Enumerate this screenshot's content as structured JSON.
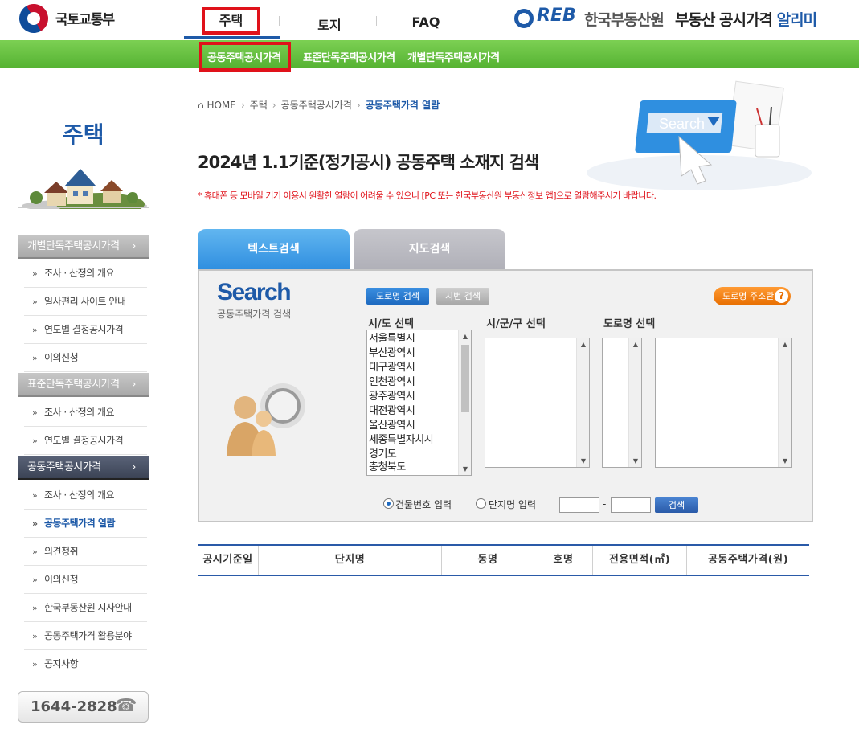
{
  "header": {
    "ministry_name": "국토교통부",
    "nav": [
      "주택",
      "토지",
      "FAQ"
    ],
    "reb_logo": "REB",
    "reb_org": "한국부동산원",
    "reb_service": "부동산 공시가격",
    "reb_service_accent": "알리미"
  },
  "subnav": [
    "공동주택공시가격",
    "표준단독주택공시가격",
    "개별단독주택공시가격"
  ],
  "sidebar": {
    "title": "주택",
    "sections": [
      {
        "label": "개별단독주택공시가격",
        "items": [
          "조사 · 산정의 개요",
          "일사편리 사이트 안내",
          "연도별 결정공시가격",
          "이의신청"
        ]
      },
      {
        "label": "표준단독주택공시가격",
        "items": [
          "조사 · 산정의 개요",
          "연도별 결정공시가격"
        ]
      },
      {
        "label": "공동주택공시가격",
        "items": [
          "조사 · 산정의 개요",
          "공동주택가격 열람",
          "의견청취",
          "이의신청",
          "한국부동산원 지사안내",
          "공동주택가격 활용분야",
          "공지사항"
        ]
      }
    ],
    "chevron": "›",
    "phone": "1644-2828"
  },
  "breadcrumb": [
    "HOME",
    "주택",
    "공동주택공시가격",
    "공동주택가격 열람"
  ],
  "page_title": "2024년 1.1기준(정기공시) 공동주택 소재지 검색",
  "notice": "* 휴대폰 등 모바일 기기 이용시 원활한 열람이 어려울 수 있으니 [PC 또는 한국부동산원 부동산정보 앱]으로 열람해주시기 바랍니다.",
  "illustration_text": "Search",
  "tabs": [
    "텍스트검색",
    "지도검색"
  ],
  "search": {
    "title": "Search",
    "subtitle": "공동주택가격 검색",
    "btn_road": "도로명 검색",
    "btn_lot": "지번 검색",
    "btn_help": "도로명 주소란",
    "help_mark": "?",
    "label_sido": "시/도 선택",
    "label_gungu": "시/군/구 선택",
    "label_road": "도로명 선택",
    "sido_options": [
      "서울특별시",
      "부산광역시",
      "대구광역시",
      "인천광역시",
      "광주광역시",
      "대전광역시",
      "울산광역시",
      "세종특별자치시",
      "경기도",
      "충청북도"
    ],
    "radio_bldg": "건물번호 입력",
    "radio_complex": "단지명 입력",
    "dash": "-",
    "btn_search": "검색"
  },
  "results": {
    "columns": [
      "공시기준일",
      "단지명",
      "동명",
      "호명",
      "전용면적(㎡)",
      "공동주택가격(원)"
    ]
  }
}
